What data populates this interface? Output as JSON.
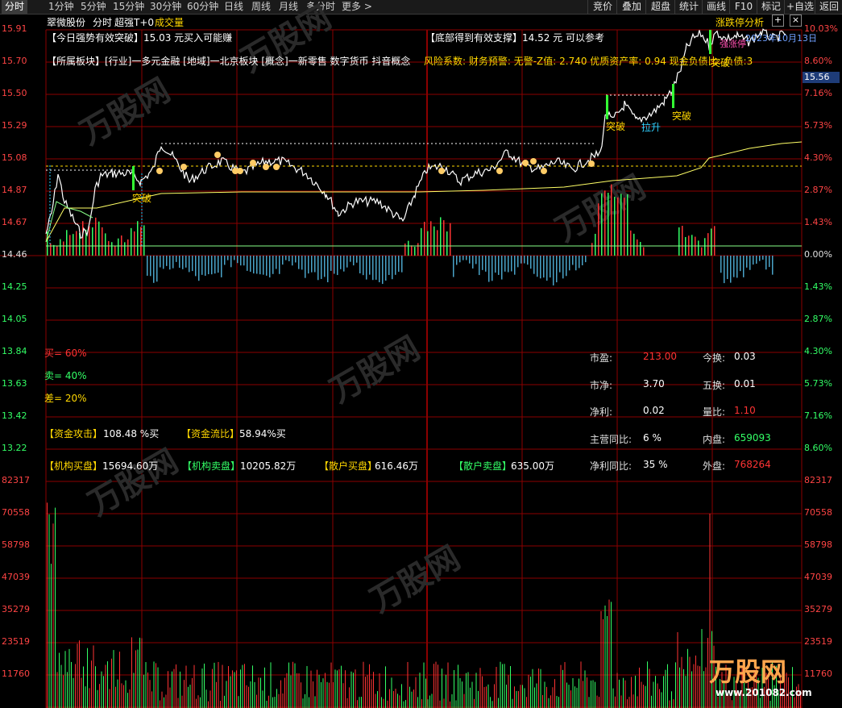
{
  "period_tabs": [
    "分时",
    "1分钟",
    "5分钟",
    "15分钟",
    "30分钟",
    "60分钟",
    "日线",
    "周线",
    "月线",
    "多分时",
    "更多 >"
  ],
  "right_buttons": [
    "竞价",
    "叠加",
    "超盘",
    "统计",
    "画线",
    "F10",
    "标记",
    "+自选",
    "返回"
  ],
  "header": {
    "stock_name": "翠微股份",
    "mode": "分时",
    "indicator": "超强T+0",
    "volume_label": "成交量",
    "limit_analysis": "涨跌停分析"
  },
  "annotations": {
    "strong_breakout": "【今日强势有效突破】15.03 元买入可能赚",
    "bottom_support": "【底部得到有效支撑】14.52 元 可以参考",
    "sector": "【所属板块】[行业]一多元金融 [地域]一北京板块 [概念]一新零售 数字货币 抖音概念",
    "risk": "风险系数: 财务预警: 无警-Z值: 2.740 优质资产率: 0.94 现金负债比: 负债:3",
    "date_tag": "2023年10月13日",
    "limit_tag": "强涨停",
    "breakout": "突破",
    "pull": "拉升",
    "current_price": "15.56"
  },
  "price_axis_left": [
    "15.91",
    "15.70",
    "15.50",
    "15.29",
    "15.08",
    "14.87",
    "14.67",
    "14.46",
    "14.25",
    "14.05",
    "13.84",
    "13.63",
    "13.42",
    "13.22"
  ],
  "pct_axis_right": [
    "10.03%",
    "8.60%",
    "7.16%",
    "5.73%",
    "4.30%",
    "2.87%",
    "1.43%",
    "0.00%",
    "1.43%",
    "2.87%",
    "4.30%",
    "5.73%",
    "7.16%",
    "8.60%"
  ],
  "volume_axis": [
    "82317",
    "70558",
    "58798",
    "47039",
    "35279",
    "23519",
    "11760"
  ],
  "sentiment": {
    "buy": "买= 60%",
    "sell": "卖= 40%",
    "diff": "差= 20%"
  },
  "fund": {
    "attack_k": "【资金攻击】",
    "attack_v": "108.48 %买",
    "flow_k": "【资金流比】",
    "flow_v": "58.94%买"
  },
  "orders": {
    "inst_buy_k": "【机构买盘】",
    "inst_buy_v": "15694.60万",
    "inst_sell_k": "【机构卖盘】",
    "inst_sell_v": "10205.82万",
    "ret_buy_k": "【散户买盘】",
    "ret_buy_v": "616.46万",
    "ret_sell_k": "【散户卖盘】",
    "ret_sell_v": "635.00万"
  },
  "metrics": {
    "pe_k": "市盈:",
    "pe_v": "213.00",
    "turn_k": "今换:",
    "turn_v": "0.03",
    "pb_k": "市净:",
    "pb_v": "3.70",
    "turn5_k": "五换:",
    "turn5_v": "0.01",
    "np_k": "净利:",
    "np_v": "0.02",
    "vr_k": "量比:",
    "vr_v": "1.10",
    "rev_k": "主营同比:",
    "rev_v": "6 %",
    "inner_k": "内盘:",
    "inner_v": "659093",
    "npy_k": "净利同比:",
    "npy_v": "35 %",
    "outer_k": "外盘:",
    "outer_v": "768264"
  },
  "watermark": {
    "brand": "万股网",
    "url": "www.201082.com"
  },
  "colors": {
    "up": "#ff3333",
    "down": "#33ff66",
    "grid": "#8b0000",
    "price": "#ffffff",
    "avg": "#ffff66",
    "highlight": "#ffd700",
    "cyan": "#30d0ff"
  }
}
